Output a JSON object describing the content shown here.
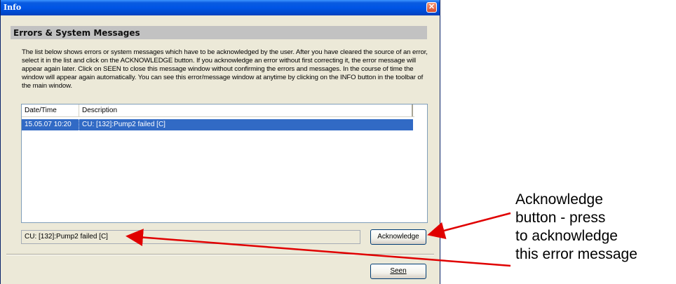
{
  "window": {
    "title": "Info",
    "close_glyph": "✕"
  },
  "header": {
    "title": "Errors & System Messages"
  },
  "description": "The list below shows errors or system messages which have to be acknowledged by the user. After you have cleared the source of an error, select it in the list and click on the ACKNOWLEDGE button. If you acknowledge an error without first correcting it, the error message will appear again later. Click on SEEN to close this message window without confirming the errors and messages. In the course of time the window will appear again automatically. You can see this error/message window at anytime by clicking on the INFO button in the toolbar of the main window.",
  "list": {
    "columns": [
      "Date/Time",
      "Description"
    ],
    "rows": [
      {
        "date": "15.05.07 10:20",
        "description": "CU: [132]:Pump2 failed [C]",
        "selected": true
      }
    ]
  },
  "status_field": {
    "value": "CU: [132]:Pump2 failed [C]"
  },
  "buttons": {
    "acknowledge": "Acknowledge",
    "seen": "Seen"
  },
  "callout": {
    "lines": [
      "Acknowledge",
      "button - press",
      "to acknowledge",
      "this error message"
    ]
  },
  "colors": {
    "titlebar": "#0055e5",
    "selection": "#316ac5",
    "arrow": "#e00000"
  }
}
